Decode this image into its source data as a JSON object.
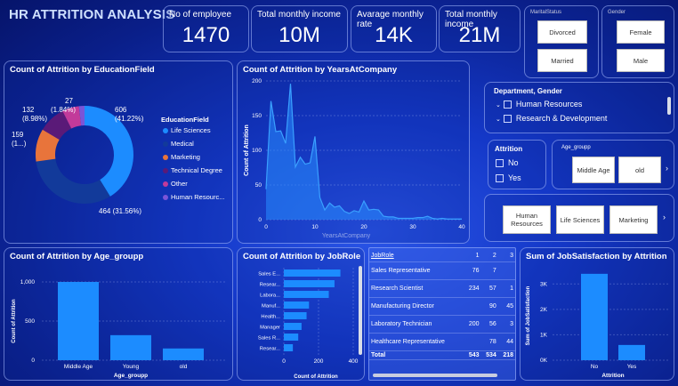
{
  "header": {
    "title": "HR ATTRITION ANALYSIS"
  },
  "kpis": [
    {
      "label": "No of employee",
      "value": "1470"
    },
    {
      "label": "Total monthly income",
      "value": "10M"
    },
    {
      "label": "Avarage monthly rate",
      "value": "14K"
    },
    {
      "label": "Total monthly income",
      "value": "21M"
    }
  ],
  "slicers": {
    "marital_status": {
      "label": "MaritalStatus",
      "options": [
        "Divorced",
        "Married"
      ]
    },
    "gender": {
      "label": "Gender",
      "options": [
        "Female",
        "Male"
      ]
    },
    "department": {
      "label": "Department, Gender",
      "options": [
        "Human Resources",
        "Research & Development"
      ]
    },
    "attrition": {
      "label": "Attrition",
      "options": [
        "No",
        "Yes"
      ]
    },
    "age_group": {
      "label": "Age_groupp",
      "options": [
        "Middle Age",
        "old"
      ]
    },
    "education_field": {
      "options": [
        "Human Resources",
        "Life Sciences",
        "Marketing"
      ]
    }
  },
  "donut": {
    "title": "Count of Attrition by EducationField",
    "legend_title": "EducationField",
    "labels": {
      "top_right": [
        "606",
        "(41.22%)"
      ],
      "bottom": "464 (31.56%)",
      "left_top": [
        "132",
        "(8.98%)"
      ],
      "left_mid": [
        "159",
        "(1...)"
      ],
      "top": [
        "27",
        "(1.84%)"
      ]
    },
    "colors": {
      "life": "#1c8cff",
      "medical": "#123a9a",
      "marketing": "#e8743b",
      "technical": "#5a1a78",
      "other": "#c23a9a",
      "hr": "#7a55d8"
    }
  },
  "chart_data": [
    {
      "type": "pie",
      "title": "Count of Attrition by EducationField",
      "legend_title": "EducationField",
      "categories": [
        "Life Sciences",
        "Medical",
        "Marketing",
        "Technical Degree",
        "Other",
        "Human Resourc..."
      ],
      "values": [
        606,
        464,
        159,
        132,
        82,
        27
      ],
      "legend_position": "right"
    },
    {
      "type": "area",
      "title": "Count of Attrition by YearsAtCompany",
      "xlabel": "YearsAtCompany",
      "ylabel": "Count of Attrition",
      "x": [
        0,
        1,
        2,
        3,
        4,
        5,
        6,
        7,
        8,
        9,
        10,
        11,
        12,
        13,
        14,
        15,
        16,
        17,
        18,
        19,
        20,
        21,
        22,
        23,
        24,
        25,
        26,
        27,
        28,
        29,
        30,
        31,
        32,
        33,
        34,
        35,
        36,
        37,
        38,
        39,
        40
      ],
      "y": [
        44,
        171,
        127,
        128,
        110,
        196,
        76,
        90,
        80,
        82,
        120,
        32,
        14,
        24,
        18,
        20,
        12,
        9,
        13,
        11,
        27,
        14,
        15,
        14,
        5,
        4,
        4,
        2,
        2,
        2,
        2,
        3,
        3,
        5,
        2,
        1,
        2,
        1,
        1,
        1,
        1
      ],
      "xlim": [
        0,
        40
      ],
      "ylim": [
        0,
        200
      ],
      "xticks": [
        0,
        10,
        20,
        30,
        40
      ],
      "yticks": [
        0,
        50,
        100,
        150,
        200
      ]
    },
    {
      "type": "bar",
      "title": "Count of Attrition by Age_groupp",
      "xlabel": "Age_groupp",
      "ylabel": "Count of Attrition",
      "categories": [
        "Middle Age",
        "Young",
        "old"
      ],
      "values": [
        1000,
        320,
        150
      ],
      "ylim": [
        0,
        1000
      ],
      "yticks": [
        "0",
        "500",
        "1,000"
      ]
    },
    {
      "type": "bar",
      "title": "Count of Attrition by JobRole",
      "xlabel": "Count of Attrition",
      "orientation": "horizontal",
      "categories": [
        "Sales E...",
        "Resear...",
        "Labora...",
        "Manuf...",
        "Health...",
        "Manager",
        "Sales R...",
        "Resear..."
      ],
      "values": [
        326,
        292,
        259,
        145,
        131,
        102,
        83,
        52
      ],
      "xlim": [
        0,
        400
      ],
      "xticks": [
        0,
        200,
        400
      ]
    },
    {
      "type": "table",
      "title": "JobRole",
      "columns": [
        "JobRole",
        "1",
        "2",
        "3"
      ],
      "rows": [
        [
          "Sales Representative",
          "76",
          "7",
          ""
        ],
        [
          "Research Scientist",
          "234",
          "57",
          "1"
        ],
        [
          "Manufacturing Director",
          "",
          "90",
          "45"
        ],
        [
          "Laboratory Technician",
          "200",
          "56",
          "3"
        ],
        [
          "Healthcare Representative",
          "",
          "78",
          "44"
        ]
      ],
      "total": [
        "Total",
        "543",
        "534",
        "218"
      ]
    },
    {
      "type": "bar",
      "title": "Sum of JobSatisfaction by Attrition",
      "xlabel": "Attrition",
      "ylabel": "Sum of JobSatisfaction",
      "categories": [
        "No",
        "Yes"
      ],
      "values": [
        3400,
        600
      ],
      "ylim": [
        0,
        3000
      ],
      "yticks": [
        "0K",
        "1K",
        "2K",
        "3K"
      ]
    }
  ]
}
